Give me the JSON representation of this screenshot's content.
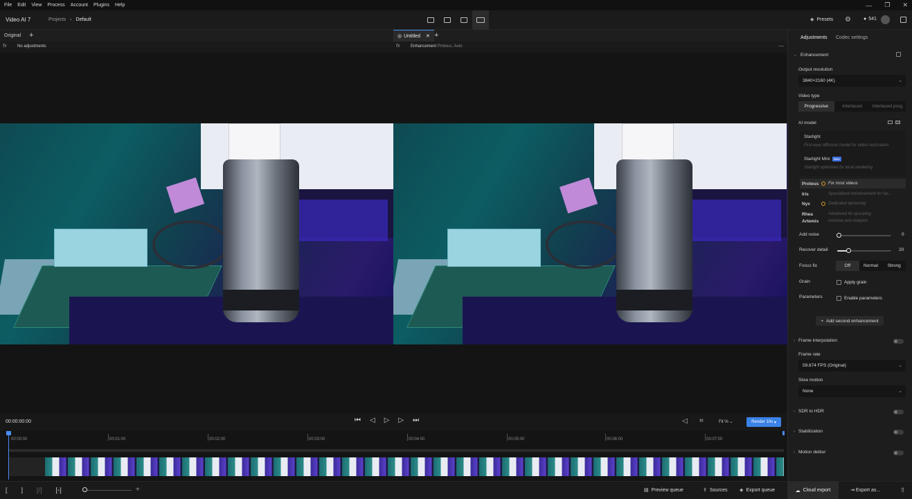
{
  "menu": [
    "File",
    "Edit",
    "View",
    "Process",
    "Account",
    "Plugins",
    "Help"
  ],
  "window_controls": [
    "—",
    "❐",
    "✕"
  ],
  "header": {
    "app_title": "Video AI 7",
    "breadcrumb": [
      "Projects",
      "Default"
    ],
    "presets_label": "Presets",
    "credits": "541"
  },
  "viewer": {
    "left_tab": "Original",
    "right_tab": "Untitled",
    "left_sub": "No adjustments",
    "right_sub_main": "Enhancement",
    "right_sub_detail": "Proteus, Auto"
  },
  "transport": {
    "timecode": "00:00:00:00",
    "fit_label": "Fit %",
    "render_label": "Render 10s"
  },
  "timeline": {
    "ticks": [
      "00:00:00",
      "00:01:00",
      "00:02:00",
      "00:03:00",
      "00:04:00",
      "00:05:00",
      "00:06:00",
      "00:07:00"
    ]
  },
  "bottombar": {
    "preview_queue": "Preview queue",
    "sources": "Sources",
    "export_queue": "Export queue",
    "cloud_export": "Cloud export",
    "export_as": "Export as..."
  },
  "panel": {
    "tabs": [
      "Adjustments",
      "Codec settings"
    ],
    "enhancement": "Enhancement",
    "output_resolution_label": "Output resolution",
    "output_resolution": "3840×2160 (4K)",
    "video_type_label": "Video type",
    "video_types": [
      "Progressive",
      "Interlaced",
      "Interlaced prog."
    ],
    "ai_model_label": "AI model",
    "starlight_title": "Starlight",
    "starlight_desc": "First-ever diffusion model for video restoration",
    "starlight_mini_title": "Starlight Mini",
    "starlight_mini_badge": "New",
    "starlight_mini_desc": "Starlight optimized for local rendering",
    "models": [
      {
        "name": "Proteus",
        "desc": "For most videos"
      },
      {
        "name": "Iris",
        "desc": "Specialized enhancement for fac..."
      },
      {
        "name": "Nyx",
        "desc": "Dedicated denoising"
      },
      {
        "name": "Rhea",
        "desc": "Advanced 4x upscaling"
      },
      {
        "name": "Artemis",
        "desc": "Denoise and sharpen"
      }
    ],
    "add_noise_label": "Add noise",
    "add_noise_value": "0",
    "add_noise_fraction": 0,
    "recover_detail_label": "Recover detail",
    "recover_detail_value": "20",
    "recover_detail_fraction": 0.2,
    "focus_fix_label": "Focus fix",
    "focus_fix_options": [
      "Off",
      "Normal",
      "Strong"
    ],
    "grain_label": "Grain",
    "apply_grain": "Apply grain",
    "parameters_label": "Parameters",
    "enable_parameters": "Enable parameters",
    "add_second": "Add second enhancement",
    "frame_interpolation": "Frame interpolation",
    "frame_rate_label": "Frame rate",
    "frame_rate": "59.674 FPS (Original)",
    "slow_motion_label": "Slow motion",
    "slow_motion": "None",
    "sdr_to_hdr": "SDR to HDR",
    "stabilization": "Stabilization",
    "motion_deblur": "Motion deblur"
  },
  "colors": {
    "accent": "#3b82e6",
    "model_dot": "#e0a020"
  }
}
